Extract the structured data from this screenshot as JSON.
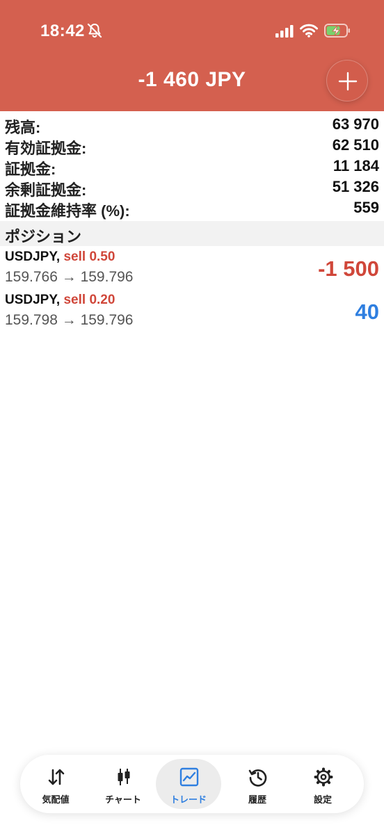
{
  "status_bar": {
    "time": "18:42"
  },
  "header": {
    "title": "-1 460 JPY"
  },
  "summary": [
    {
      "label": "残高:",
      "value": "63 970"
    },
    {
      "label": "有効証拠金:",
      "value": "62 510"
    },
    {
      "label": "証拠金:",
      "value": "11 184"
    },
    {
      "label": "余剰証拠金:",
      "value": "51 326"
    },
    {
      "label": "証拠金維持率 (%):",
      "value": "559"
    }
  ],
  "positions_section": {
    "title": "ポジション"
  },
  "positions": [
    {
      "symbol": "USDJPY,",
      "side": "sell 0.50",
      "prices": "159.766 → 159.796",
      "profit": "-1 500"
    },
    {
      "symbol": "USDJPY,",
      "side": "sell 0.20",
      "prices": "159.798 → 159.796",
      "profit": "40"
    }
  ],
  "tabbar": {
    "items": [
      {
        "label": "気配値",
        "icon": "quotes-arrows-icon"
      },
      {
        "label": "チャート",
        "icon": "candlestick-chart-icon"
      },
      {
        "label": "トレード",
        "icon": "trade-chart-icon"
      },
      {
        "label": "履歴",
        "icon": "history-clock-icon"
      },
      {
        "label": "設定",
        "icon": "gear-icon"
      }
    ],
    "active_index": 2
  },
  "colors": {
    "header_bg": "#d4604f",
    "loss": "#d0473a",
    "gain": "#2f7fe0",
    "active_tab": "#2f7fe0"
  }
}
